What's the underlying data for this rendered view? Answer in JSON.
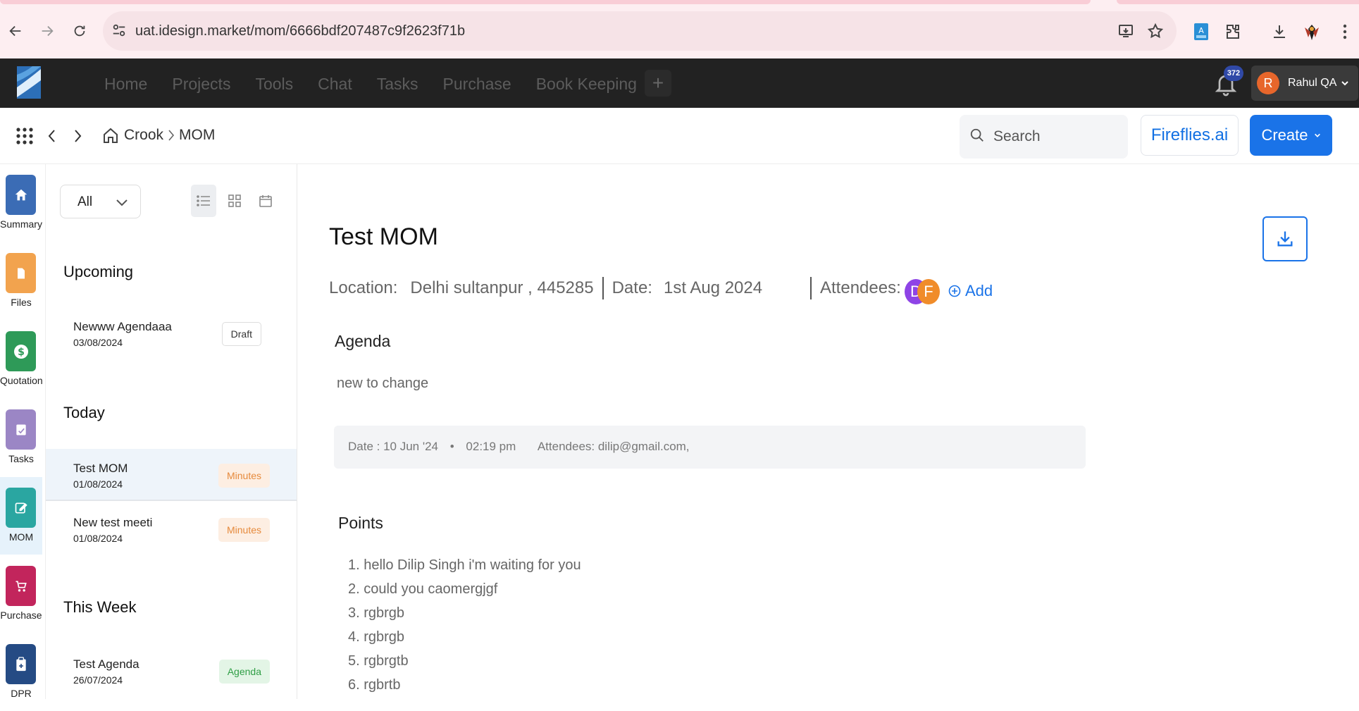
{
  "browser": {
    "url": "uat.idesign.market/mom/6666bdf207487c9f2623f71b"
  },
  "appbar": {
    "menu": [
      "Home",
      "Projects",
      "Tools",
      "Chat",
      "Tasks",
      "Purchase",
      "Book Keeping"
    ],
    "plus": "+",
    "notification_count": "372",
    "user_initial": "R",
    "user_name": "Rahul QA"
  },
  "subbar": {
    "breadcrumb": [
      "Crook",
      "MOM"
    ],
    "search_placeholder": "Search",
    "fireflies_label": "Fireflies.ai",
    "create_label": "Create"
  },
  "leftnav": [
    {
      "label": "Summary",
      "icon": "home-icon",
      "color": "#3b6cb5"
    },
    {
      "label": "Files",
      "icon": "folder-icon",
      "color": "#f2a34e"
    },
    {
      "label": "Quotation",
      "icon": "dollar-icon",
      "color": "#2e9a58"
    },
    {
      "label": "Tasks",
      "icon": "task-icon",
      "color": "#9b86c5"
    },
    {
      "label": "MOM",
      "icon": "edit-icon",
      "color": "#2aa6a1"
    },
    {
      "label": "Purchase",
      "icon": "cart-icon",
      "color": "#c2255c"
    },
    {
      "label": "DPR",
      "icon": "clipboard-icon",
      "color": "#254b84"
    }
  ],
  "midpanel": {
    "filter_value": "All",
    "sections": {
      "upcoming": "Upcoming",
      "today": "Today",
      "this_week": "This Week"
    },
    "items": [
      {
        "title": "Newww Agendaaa",
        "date": "03/08/2024",
        "tag": "Draft"
      },
      {
        "title": "Test MOM",
        "date": "01/08/2024",
        "tag": "Minutes"
      },
      {
        "title": "New test meeti",
        "date": "01/08/2024",
        "tag": "Minutes"
      },
      {
        "title": "Test Agenda",
        "date": "26/07/2024",
        "tag": "Agenda"
      }
    ]
  },
  "main": {
    "title": "Test MOM",
    "location_label": "Location:",
    "location_value": "Delhi sultanpur , 445285",
    "date_label": "Date:",
    "date_value": "1st Aug 2024",
    "attendees_label": "Attendees:",
    "attendee_initials": [
      "D",
      "F"
    ],
    "add_label": "Add",
    "agenda_heading": "Agenda",
    "agenda_text": "new to change",
    "info_date": "Date : 10 Jun '24",
    "info_dot": "•",
    "info_time": "02:19 pm",
    "info_attendees": "Attendees: dilip@gmail.com,",
    "points_heading": "Points",
    "points": [
      "1. hello Dilip Singh i'm waiting for you",
      "2. could you caomergjgf",
      "3. rgbrgb",
      "4. rgbrgb",
      "5. rgbrgtb",
      "6. rgbrtb"
    ]
  }
}
